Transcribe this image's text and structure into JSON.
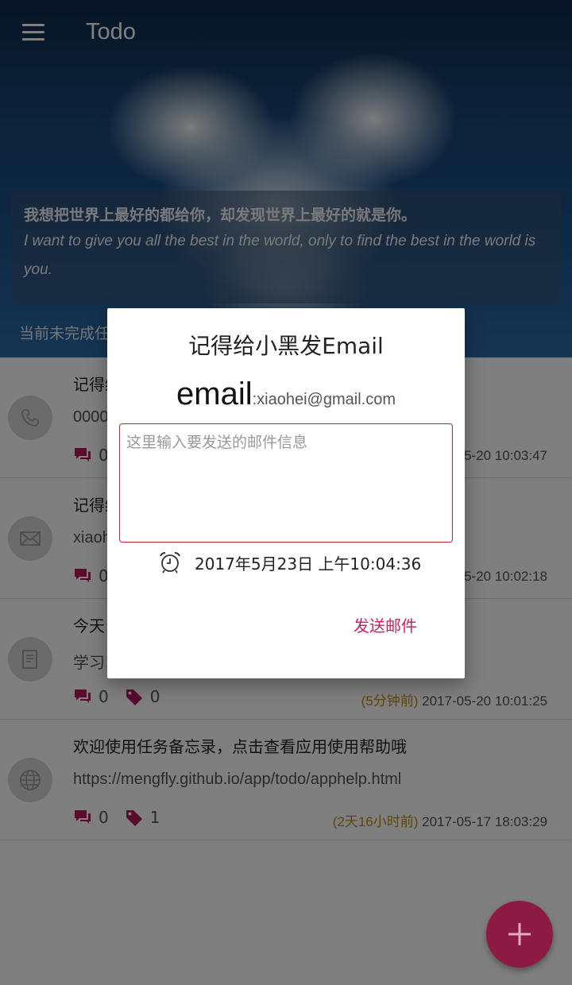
{
  "app": {
    "title": "Todo"
  },
  "banner": {
    "quote_cn": "我想把世界上最好的都给你，却发现世界上最好的就是你。",
    "quote_en": "I want to give you all the best in the world, only to find the best in the world is you.",
    "status_text": "当前未完成任"
  },
  "tasks": [
    {
      "title": "记得给小黑打电话",
      "desc": "0000",
      "comments": "0",
      "tags": "",
      "ago": "",
      "time": "2017-05-20 10:03:47",
      "icon": "phone-icon"
    },
    {
      "title": "记得给小黑发Email",
      "desc": "xiaohei@gmail.com",
      "comments": "0",
      "tags": "",
      "ago": "",
      "time": "2017-05-20 10:02:18",
      "icon": "mail-icon"
    },
    {
      "title": "今天",
      "desc": "学习",
      "comments": "0",
      "tags": "0",
      "ago": "(5分钟前)",
      "time": "2017-05-20 10:01:25",
      "icon": "document-icon"
    },
    {
      "title": "欢迎使用任务备忘录，点击查看应用使用帮助哦",
      "desc": "https://mengfly.github.io/app/todo/apphelp.html",
      "comments": "0",
      "tags": "1",
      "ago": "(2天16小时前)",
      "time": "2017-05-17 18:03:29",
      "icon": "globe-icon"
    }
  ],
  "dialog": {
    "title": "记得给小黑发Email",
    "email_label": "email",
    "email_address": ":xiaohei@gmail.com",
    "message_placeholder": "这里输入要发送的邮件信息",
    "message_value": "",
    "datetime": "2017年5月23日 上午10:04:36",
    "send_label": "发送邮件"
  },
  "colors": {
    "accent": "#d81b60",
    "fab": "#8d1a42",
    "input_border": "#b3262a",
    "ago_text": "#c08a14"
  }
}
